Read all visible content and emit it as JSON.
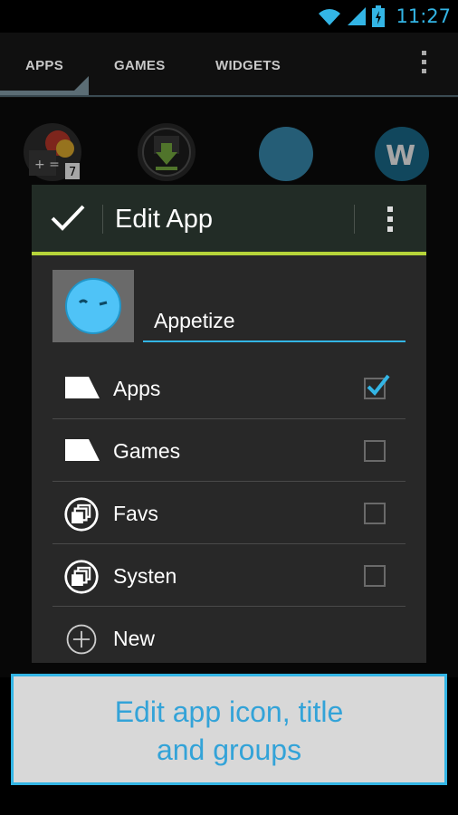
{
  "status_bar": {
    "time": "11:27"
  },
  "tabs": [
    {
      "label": "APPS",
      "active": true
    },
    {
      "label": "GAMES",
      "active": false
    },
    {
      "label": "WIDGETS",
      "active": false
    }
  ],
  "dialog": {
    "title": "Edit App",
    "app_name": "Appetize",
    "groups": [
      {
        "label": "Apps",
        "icon": "tray-icon",
        "checked": true
      },
      {
        "label": "Games",
        "icon": "tray-icon",
        "checked": false
      },
      {
        "label": "Favs",
        "icon": "stack-icon",
        "checked": false
      },
      {
        "label": "Systen",
        "icon": "stack-icon",
        "checked": false
      },
      {
        "label": "New",
        "icon": "add-circle-icon",
        "checked": null
      }
    ]
  },
  "caption": {
    "line1": "Edit app icon, title",
    "line2": "and groups"
  },
  "colors": {
    "accent": "#33b5e5",
    "header_line": "#b6d43a",
    "dialog_bg": "#282828"
  }
}
